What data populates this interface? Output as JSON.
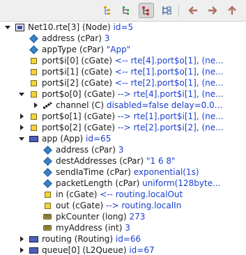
{
  "toolbar": {
    "buttons": [
      {
        "name": "sort-icon",
        "active": false
      },
      {
        "name": "group-icon",
        "active": false
      },
      {
        "name": "flat-tree-icon",
        "active": true
      },
      {
        "name": "collapse-all-icon",
        "active": false
      },
      {
        "name": "back-icon",
        "active": false
      },
      {
        "name": "forward-icon",
        "active": false
      },
      {
        "name": "up-icon",
        "active": false
      }
    ],
    "colors": {
      "arrows": "#b07060",
      "accent": "#c03030"
    }
  },
  "tree": {
    "rows": [
      {
        "depth": 0,
        "exp": "down",
        "icon": "netmod",
        "name": "Net10.rte[3] (Node)",
        "value": "id=5"
      },
      {
        "depth": 1,
        "exp": "none",
        "icon": "diamond",
        "name": "address (cPar)",
        "value": "3"
      },
      {
        "depth": 1,
        "exp": "none",
        "icon": "diamond",
        "name": "appType (cPar)",
        "value": "\"App\""
      },
      {
        "depth": 1,
        "exp": "none",
        "icon": "gate",
        "name": "port$i[0] (cGate)",
        "value": "<-- rte[4].port$o[1], (ne..."
      },
      {
        "depth": 1,
        "exp": "none",
        "icon": "gate",
        "name": "port$i[1] (cGate)",
        "value": "<-- rte[1].port$o[1], (ne..."
      },
      {
        "depth": 1,
        "exp": "none",
        "icon": "gate",
        "name": "port$i[2] (cGate)",
        "value": "<-- rte[2].port$o[1], (ne..."
      },
      {
        "depth": 1,
        "exp": "down",
        "icon": "gate",
        "name": "port$o[0] (cGate)",
        "value": "--> rte[4].port$i[1], (ne..."
      },
      {
        "depth": 2,
        "exp": "right",
        "icon": "cable",
        "name": "channel (C)",
        "value": "disabled=false delay=0.0..."
      },
      {
        "depth": 1,
        "exp": "right",
        "icon": "gate",
        "name": "port$o[1] (cGate)",
        "value": "--> rte[1].port$i[1], (ne..."
      },
      {
        "depth": 1,
        "exp": "right",
        "icon": "gate",
        "name": "port$o[2] (cGate)",
        "value": "--> rte[2].port$i[2], (ne..."
      },
      {
        "depth": 1,
        "exp": "down",
        "icon": "module",
        "name": "app (App)",
        "value": "id=65"
      },
      {
        "depth": 2,
        "exp": "none",
        "icon": "diamond",
        "name": "address (cPar)",
        "value": "3"
      },
      {
        "depth": 2,
        "exp": "none",
        "icon": "diamond",
        "name": "destAddresses (cPar)",
        "value": "\"1 6 8\""
      },
      {
        "depth": 2,
        "exp": "none",
        "icon": "diamond",
        "name": "sendIaTime (cPar)",
        "value": "exponential(1s)"
      },
      {
        "depth": 2,
        "exp": "none",
        "icon": "diamond",
        "name": "packetLength (cPar)",
        "value": "uniform(128byte..."
      },
      {
        "depth": 2,
        "exp": "none",
        "icon": "gate",
        "name": "in (cGate)",
        "value": "<-- routing.localOut"
      },
      {
        "depth": 2,
        "exp": "none",
        "icon": "gate",
        "name": "out (cGate)",
        "value": "--> routing.localIn"
      },
      {
        "depth": 2,
        "exp": "none",
        "icon": "drum",
        "name": "pkCounter (long)",
        "value": "273"
      },
      {
        "depth": 2,
        "exp": "none",
        "icon": "drum",
        "name": "myAddress (int)",
        "value": "3"
      },
      {
        "depth": 1,
        "exp": "right",
        "icon": "module",
        "name": "routing (Routing)",
        "value": "id=66"
      },
      {
        "depth": 1,
        "exp": "right",
        "icon": "module",
        "name": "queue[0] (L2Queue)",
        "value": "id=67"
      }
    ]
  }
}
